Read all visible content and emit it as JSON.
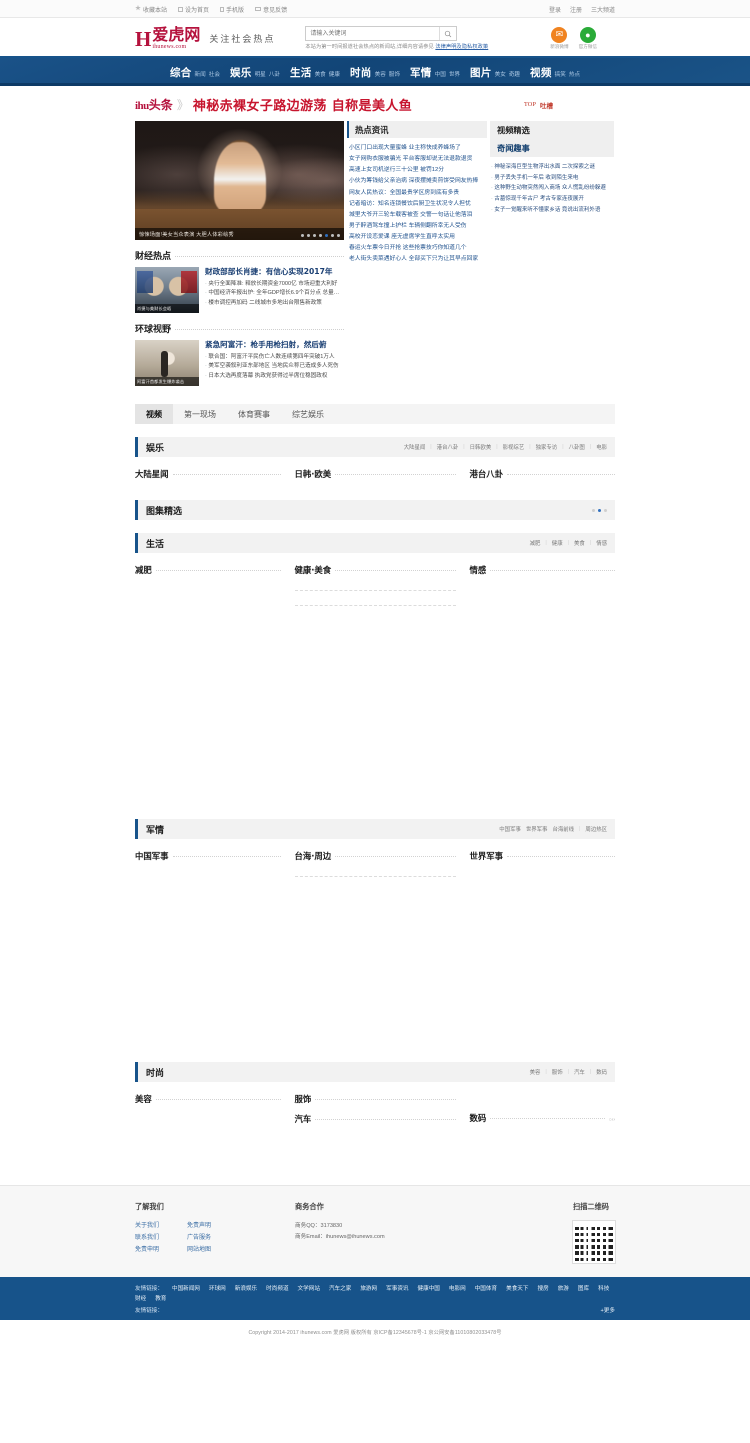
{
  "topbar": {
    "left": [
      {
        "label": "收藏本站",
        "icon": "star-icon"
      },
      {
        "label": "设为首页",
        "icon": "home-icon"
      },
      {
        "label": "手机版",
        "icon": "mobile-icon"
      },
      {
        "label": "意见反馈",
        "icon": "mail-icon"
      }
    ],
    "right": [
      {
        "label": "登录"
      },
      {
        "label": "注册"
      },
      {
        "label": "三大频道"
      }
    ]
  },
  "header": {
    "logo_mark": "H",
    "logo_cn": "爱虎网",
    "logo_domain": "ihunews.com",
    "slogan": "关注社会热点",
    "search": {
      "value": "",
      "placeholder": "请输入关键词",
      "button_icon": "search-icon"
    },
    "search_sub_prefix": "本站为第一时间报道社会热点的新闻站,详细内容请参见",
    "search_sub_link": "法律声明及隐私权政策",
    "apps": [
      {
        "label": "新浪微博",
        "icon": "weibo-icon",
        "color": "#f08320",
        "glyph": "✉"
      },
      {
        "label": "官方微信",
        "icon": "wechat-icon",
        "color": "#2aab38",
        "glyph": "●"
      }
    ]
  },
  "nav": [
    {
      "main": "综合",
      "subs": [
        "新闻",
        "社会"
      ]
    },
    {
      "main": "娱乐",
      "subs": [
        "明星",
        "八卦"
      ]
    },
    {
      "main": "生活",
      "subs": [
        "美食",
        "健康"
      ]
    },
    {
      "main": "时尚",
      "subs": [
        "美容",
        "服饰"
      ]
    },
    {
      "main": "军情",
      "subs": [
        "中国",
        "世界"
      ]
    },
    {
      "main": "图片",
      "subs": [
        "美女",
        "奇趣"
      ]
    },
    {
      "main": "视频",
      "subs": [
        "搞笑",
        "热点"
      ]
    }
  ],
  "headline": {
    "badge_en": "ihu",
    "badge_cn": "头条",
    "arrow": "》",
    "title": "神秘赤裸女子路边游荡 自称是美人鱼",
    "top_label": "TOP",
    "tag": "吐槽"
  },
  "carousel": {
    "caption": "惊悚场面!美女当众表演 大胆人体彩绘秀",
    "dots": 7,
    "active_dot": 4
  },
  "finance": {
    "section_title": "财经热点",
    "thumb_caption": "肖捷与美财长会晤",
    "headline": "财政部部长肖捷：有信心实现2017年",
    "items": [
      "央行全面降准: 释放长期资金7000亿 市场迎重大利好",
      "中国经济年报出炉: 全年GDP增长6.9个百分点 总量创新高",
      "楼市调控再加码 二线城市多地出台限售新政策"
    ]
  },
  "global": {
    "section_title": "环球视野",
    "thumb_caption": "阿富汗首都发生爆炸袭击",
    "headline": "紧急阿富汗：枪手用枪扫射，然后俯",
    "items": [
      "联合国：阿富汗平民伤亡人数连续第四年突破1万人",
      "美军空袭叙利亚东部地区 当地民众称已造成多人死伤",
      "日本大选再度落幕 执政党获得过半席位稳固政权"
    ]
  },
  "hot_news": {
    "title": "热点资讯",
    "items": [
      "小区门口出现大量蜜蜂 业主称快成养蜂场了",
      "女子网购衣服被骗光 平台客服却说无法退款退货",
      "高速上女司机逆行三十公里 被罚12分",
      "小伙为筹钱给父亲治病 深夜摆摊卖煎饼受网友热捧",
      "网友人民热议：全国最贵学区房到底有多贵",
      "记者暗访：知名连锁餐饮后厨卫生状况令人担忧",
      "城里大爷开三轮车载客被查 交警一句话让他落泪",
      "男子醉酒驾车撞上护栏 车辆侧翻所幸无人受伤",
      "高校开设恋爱课 座无虚席学生直呼太实用",
      "春运火车票今日开抢 这些抢票技巧你知道几个",
      "老人街头卖菜遇好心人 全部买下只为让其早点回家"
    ]
  },
  "right_panel": {
    "tab_video": "视频精选",
    "tab_odd": "奇闻趣事",
    "items": [
      "神秘深海巨型生物浮出水面 二次探索之谜",
      "男子丢失手机一年后 收到陌生来电",
      "这种野生动物突然闯入商场 众人慌乱纷纷躲避",
      "古墓惊现千年古尸 考古专家连夜展开",
      "女子一觉醒来听不懂家乡话 竟说出流利外语"
    ]
  },
  "tabs": [
    {
      "label": "视频",
      "active": true
    },
    {
      "label": "第一现场",
      "active": false
    },
    {
      "label": "体育赛事",
      "active": false
    },
    {
      "label": "综艺娱乐",
      "active": false
    }
  ],
  "channels": [
    {
      "name": "娱乐",
      "links": [
        "大陆星闻",
        "港台八卦",
        "日韩欧美",
        "影视综艺",
        "独家专访",
        "八卦图",
        "电影"
      ],
      "subcols": [
        "大陆星闻",
        "日韩·欧美",
        "港台八卦"
      ]
    },
    {
      "name": "生活",
      "links": [
        "减肥",
        "健康",
        "美食",
        "情感"
      ],
      "subcols": [
        "减肥",
        "健康·美食",
        "情感"
      ]
    },
    {
      "name": "军情",
      "links": [
        "中国军事",
        "世界军事",
        "台海前线",
        "周边热区"
      ],
      "subcols": [
        "中国军事",
        "台海·周边",
        "世界军事"
      ]
    },
    {
      "name": "时尚",
      "links": [
        "美容",
        "服饰",
        "汽车",
        "数码"
      ],
      "subcols": [
        "美容",
        "服饰",
        "汽车",
        "数码"
      ]
    }
  ],
  "gallery": {
    "title": "图集精选",
    "dots": 3,
    "active_dot": 1
  },
  "footer": {
    "about": {
      "title": "了解我们",
      "links": [
        "关于我们",
        "免责声明",
        "联系我们",
        "广告服务",
        "免责申明",
        "网站地图"
      ]
    },
    "biz": {
      "title": "商务合作",
      "qq_line": "商务QQ：3173830",
      "mail_line": "商务Email：ihunews@ihunews.com"
    },
    "qr": {
      "title": "扫描二维码",
      "icon": "qr-code-icon"
    }
  },
  "linkbar": {
    "label": "友情链接：",
    "links": [
      "中国新闻网",
      "环球网",
      "新浪娱乐",
      "时尚频道",
      "文学网站",
      "汽车之家",
      "旅游网",
      "军事资讯",
      "健康中国",
      "电影网",
      "中国体育",
      "美食天下",
      "搜房",
      "旅游",
      "图库",
      "科技",
      "财经",
      "教育"
    ],
    "more": "+更多"
  },
  "copyright": "Copyright 2014-2017 ihunews.com 爱虎网 版权所有 京ICP备12345678号-1 京公网安备11010802033478号"
}
